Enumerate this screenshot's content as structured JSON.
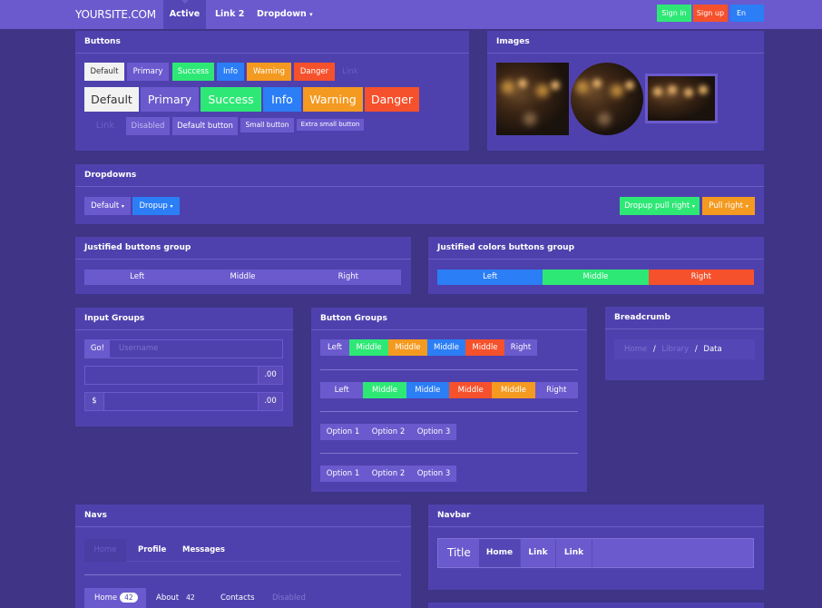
{
  "navbar": {
    "brand": "YOURSITE.COM",
    "links": [
      "Active",
      "Link 2",
      "Dropdown"
    ],
    "dropdown_caret": "▾",
    "signin": "Sign in",
    "signup": "Sign up",
    "lang": "En"
  },
  "buttons": {
    "title": "Buttons",
    "row1": [
      "Default",
      "Primary",
      "Success",
      "Info",
      "Warning",
      "Danger",
      "Link"
    ],
    "row2": [
      "Default",
      "Primary",
      "Success",
      "Info",
      "Warning",
      "Danger"
    ],
    "row3": [
      "Link",
      "Disabled",
      "Default button",
      "Small button",
      "Extra small button"
    ]
  },
  "images": {
    "title": "Images"
  },
  "dropdowns": {
    "title": "Dropdowns",
    "default": "Default",
    "dropup": "Dropup",
    "dropup_right": "Dropup pull right",
    "pull_right": "Pull right",
    "caret": "▾"
  },
  "justified": {
    "title": "Justified buttons group",
    "items": [
      "Left",
      "Middle",
      "Right"
    ]
  },
  "justified_colors": {
    "title": "Justified colors buttons group",
    "items": [
      "Left",
      "Middle",
      "Right"
    ]
  },
  "input_groups": {
    "title": "Input Groups",
    "go": "Go!",
    "username_placeholder": "Username",
    "suffix": ".00",
    "prefix": "$"
  },
  "button_groups": {
    "title": "Button Groups",
    "row1": [
      "Left",
      "Middle",
      "Middle",
      "Middle",
      "Middle",
      "Right"
    ],
    "row2": [
      "Left",
      "Middle",
      "Middle",
      "Middle",
      "Middle",
      "Right"
    ],
    "options": [
      "Option 1",
      "Option 2",
      "Option 3"
    ]
  },
  "breadcrumb": {
    "title": "Breadcrumb",
    "items": [
      "Home",
      "Library",
      "Data"
    ],
    "sep": "/"
  },
  "navs": {
    "title": "Navs",
    "tabs": [
      "Home",
      "Profile",
      "Messages"
    ],
    "pills": [
      "Home",
      "About",
      "Contacts",
      "Disabled"
    ],
    "home_badge": "42",
    "about_badge": "42"
  },
  "navbar_demo": {
    "title": "Navbar",
    "brand": "Title",
    "links": [
      "Home",
      "Link",
      "Link"
    ]
  }
}
